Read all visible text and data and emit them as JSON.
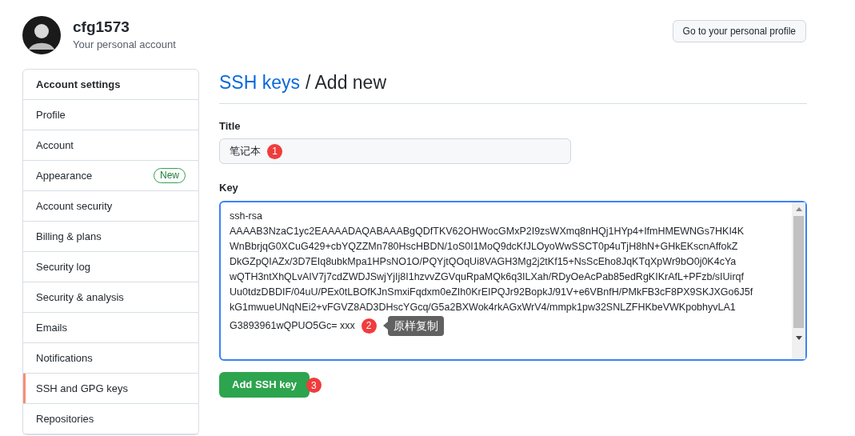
{
  "profile": {
    "username": "cfg1573",
    "subtitle": "Your personal account"
  },
  "profile_button": "Go to your personal profile",
  "sidebar": {
    "heading": "Account settings",
    "items": [
      {
        "label": "Profile",
        "selected": false
      },
      {
        "label": "Account",
        "selected": false
      },
      {
        "label": "Appearance",
        "badge": "New",
        "selected": false
      },
      {
        "label": "Account security",
        "selected": false
      },
      {
        "label": "Billing & plans",
        "selected": false
      },
      {
        "label": "Security log",
        "selected": false
      },
      {
        "label": "Security & analysis",
        "selected": false
      },
      {
        "label": "Emails",
        "selected": false
      },
      {
        "label": "Notifications",
        "selected": false
      },
      {
        "label": "SSH and GPG keys",
        "selected": true
      },
      {
        "label": "Repositories",
        "selected": false
      }
    ]
  },
  "page": {
    "breadcrumb_link": "SSH keys",
    "title": "/ Add new"
  },
  "form": {
    "title_label": "Title",
    "title_value": "笔记本",
    "title_marker": "1",
    "key_label": "Key",
    "key_lines": [
      "ssh-rsa",
      "AAAAB3NzaC1yc2EAAAADAQABAAABgQDfTKV62OHWocGMxP2I9zsWXmq8nHQj1HYp4+IfmHMEWNGs7HKI4K",
      "WnBbrjqG0XCuG429+cbYQZZMn780HscHBDN/1oS0I1MoQ9dcKfJLOyoWwSSCT0p4uTjH8hN+GHkEKscnAffokZ",
      "DkGZpQIAZx/3D7EIq8ubkMpa1HPsNO1O/PQYjtQOqUi8VAGH3Mg2j2tKf15+NsScEho8JqKTqXpWr9bO0j0K4cYa",
      "wQTH3ntXhQLvAIV7j7cdZWDJSwjYjIj8I1hzvvZGVquRpaMQk6q3ILXah/RDyOeAcPab85edRgKIKrAfL+PFzb/sIUirqf",
      "Uu0tdzDBDIF/04uU/PEx0tLBOfKJnSmxiFqdxm0eZIh0KrEIPQJr92BopkJ/91V+e6VBnfH/PMkFB3cF8PX9SKJXGo6J5f",
      "kG1mwueUNqNEi2+vFGVZ8AD3DHscYGcq/G5a2BXWok4rkAGxWrV4/mmpk1pw32SNLZFHKbeVWKpobhyvLA1",
      "G3893961wQPUO5Gc= xxx"
    ],
    "key_marker": "2",
    "key_tooltip": "原样复制",
    "submit": "Add SSH key",
    "submit_marker": "3"
  }
}
